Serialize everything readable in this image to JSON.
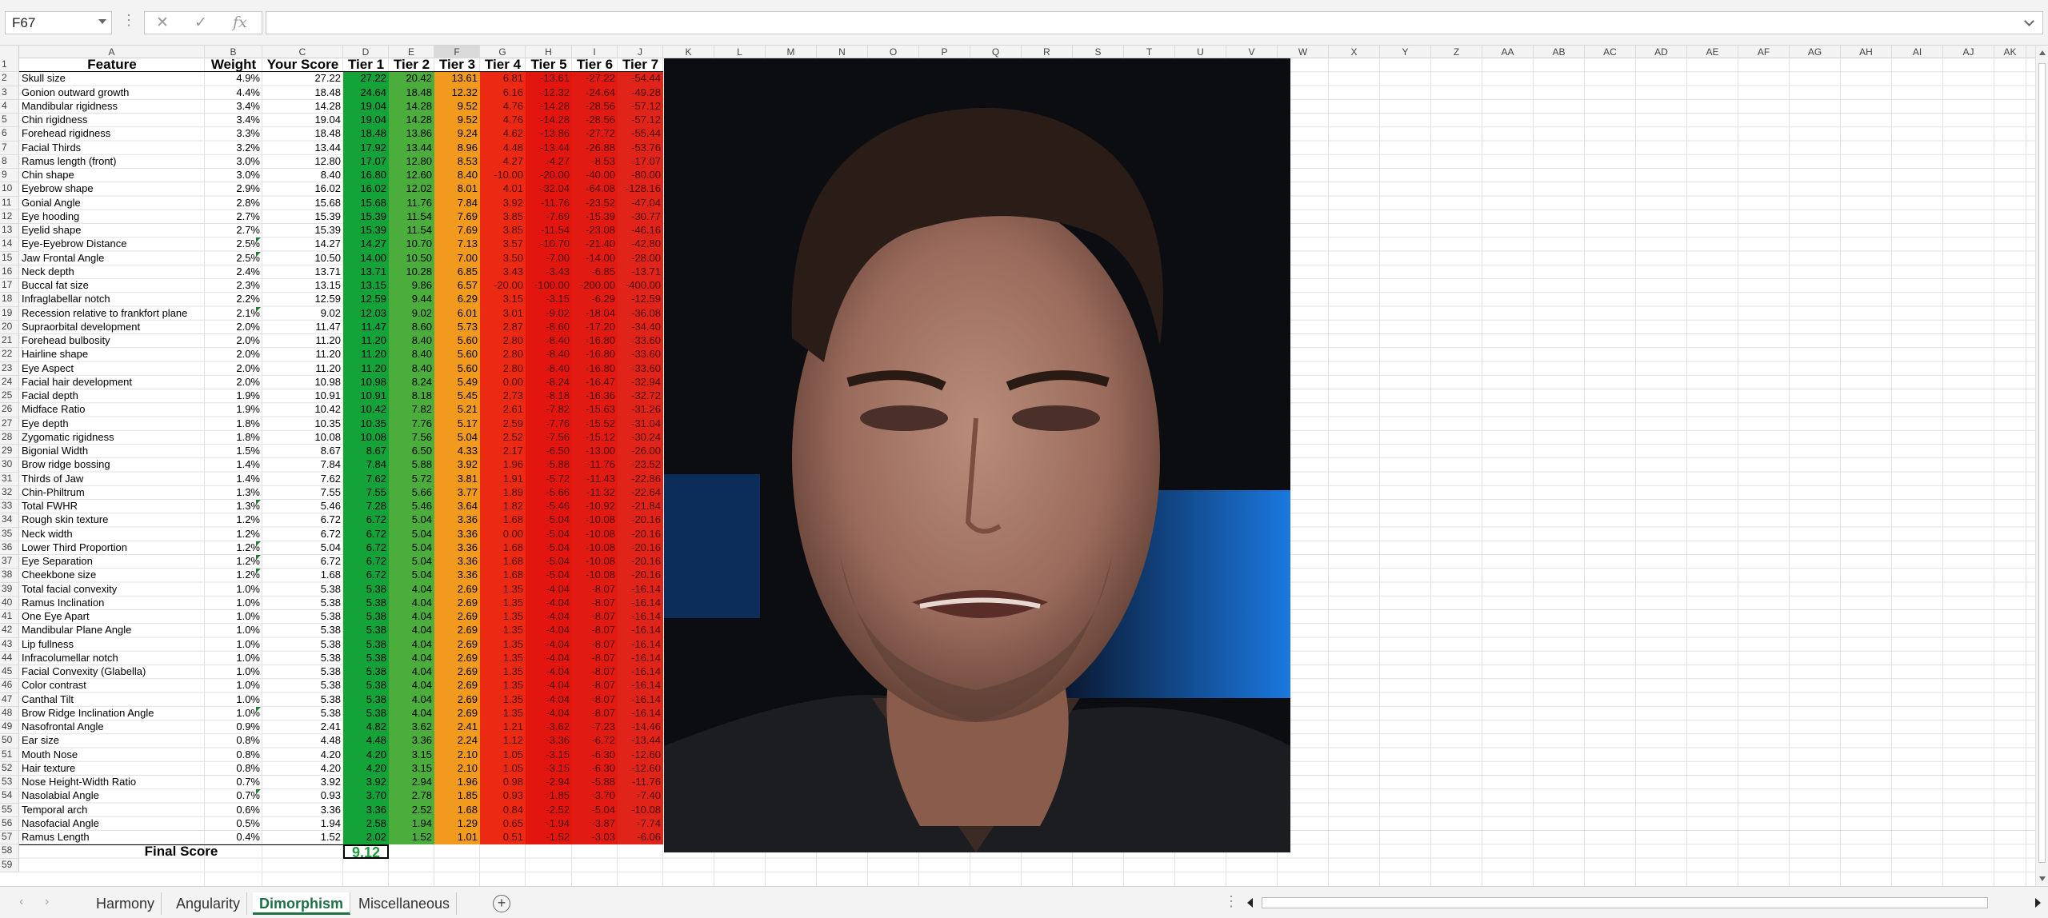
{
  "formula_bar": {
    "name_box": "F67",
    "formula": "",
    "icons": [
      "close-icon",
      "check-icon",
      "fx-icon"
    ]
  },
  "columns": [
    "A",
    "B",
    "C",
    "D",
    "E",
    "F",
    "G",
    "H",
    "I",
    "J",
    "K",
    "L",
    "M",
    "N",
    "O",
    "P",
    "Q",
    "R",
    "S",
    "T",
    "U",
    "V",
    "W",
    "X",
    "Y",
    "Z",
    "AA",
    "AB",
    "AC",
    "AD",
    "AE",
    "AF",
    "AG",
    "AH",
    "AI",
    "AJ",
    "AK"
  ],
  "selected_column": "F",
  "headers": [
    "Feature",
    "Weight",
    "Your Score",
    "Tier 1",
    "Tier 2",
    "Tier 3",
    "Tier 4",
    "Tier 5",
    "Tier 6",
    "Tier 7"
  ],
  "tier_colors": [
    "#14a339",
    "#4bad3b",
    "#f29a1e",
    "#ec2a13",
    "#e2160f",
    "#e11a12",
    "#e1241a"
  ],
  "rows": [
    [
      "Skull size",
      "4.9%",
      "27.22",
      "27.22",
      "20.42",
      "13.61",
      "6.81",
      "-13.61",
      "-27.22",
      "-54.44"
    ],
    [
      "Gonion outward growth",
      "4.4%",
      "18.48",
      "24.64",
      "18.48",
      "12.32",
      "6.16",
      "-12.32",
      "-24.64",
      "-49.28"
    ],
    [
      "Mandibular rigidness",
      "3.4%",
      "14.28",
      "19.04",
      "14.28",
      "9.52",
      "4.76",
      "-14.28",
      "-28.56",
      "-57.12"
    ],
    [
      "Chin rigidness",
      "3.4%",
      "19.04",
      "19.04",
      "14.28",
      "9.52",
      "4.76",
      "-14.28",
      "-28.56",
      "-57.12"
    ],
    [
      "Forehead rigidness",
      "3.3%",
      "18.48",
      "18.48",
      "13.86",
      "9.24",
      "4.62",
      "-13.86",
      "-27.72",
      "-55.44"
    ],
    [
      "Facial Thirds",
      "3.2%",
      "13.44",
      "17.92",
      "13.44",
      "8.96",
      "4.48",
      "-13.44",
      "-26.88",
      "-53.76"
    ],
    [
      "Ramus length (front)",
      "3.0%",
      "12.80",
      "17.07",
      "12.80",
      "8.53",
      "4.27",
      "-4.27",
      "-8.53",
      "-17.07"
    ],
    [
      "Chin shape",
      "3.0%",
      "8.40",
      "16.80",
      "12.60",
      "8.40",
      "-10.00",
      "-20.00",
      "-40.00",
      "-80.00"
    ],
    [
      "Eyebrow shape",
      "2.9%",
      "16.02",
      "16.02",
      "12.02",
      "8.01",
      "4.01",
      "-32.04",
      "-64.08",
      "-128.16"
    ],
    [
      "Gonial Angle",
      "2.8%",
      "15.68",
      "15.68",
      "11.76",
      "7.84",
      "3.92",
      "-11.76",
      "-23.52",
      "-47.04"
    ],
    [
      "Eye hooding",
      "2.7%",
      "15.39",
      "15.39",
      "11.54",
      "7.69",
      "3.85",
      "-7.69",
      "-15.39",
      "-30.77"
    ],
    [
      "Eyelid shape",
      "2.7%",
      "15.39",
      "15.39",
      "11.54",
      "7.69",
      "3.85",
      "-11.54",
      "-23.08",
      "-46.16"
    ],
    [
      "Eye-Eyebrow Distance",
      "2.5%",
      "14.27",
      "14.27",
      "10.70",
      "7.13",
      "3.57",
      "-10.70",
      "-21.40",
      "-42.80"
    ],
    [
      "Jaw Frontal Angle",
      "2.5%",
      "10.50",
      "14.00",
      "10.50",
      "7.00",
      "3.50",
      "-7.00",
      "-14.00",
      "-28.00"
    ],
    [
      "Neck depth",
      "2.4%",
      "13.71",
      "13.71",
      "10.28",
      "6.85",
      "3.43",
      "-3.43",
      "-6.85",
      "-13.71"
    ],
    [
      "Buccal fat size",
      "2.3%",
      "13.15",
      "13.15",
      "9.86",
      "6.57",
      "-20.00",
      "-100.00",
      "-200.00",
      "-400.00"
    ],
    [
      "Infraglabellar notch",
      "2.2%",
      "12.59",
      "12.59",
      "9.44",
      "6.29",
      "3.15",
      "-3.15",
      "-6.29",
      "-12.59"
    ],
    [
      "Recession relative to frankfort plane",
      "2.1%",
      "9.02",
      "12.03",
      "9.02",
      "6.01",
      "3.01",
      "-9.02",
      "-18.04",
      "-36.08"
    ],
    [
      "Supraorbital development",
      "2.0%",
      "11.47",
      "11.47",
      "8.60",
      "5.73",
      "2.87",
      "-8.60",
      "-17.20",
      "-34.40"
    ],
    [
      "Forehead bulbosity",
      "2.0%",
      "11.20",
      "11.20",
      "8.40",
      "5.60",
      "2.80",
      "-8.40",
      "-16.80",
      "-33.60"
    ],
    [
      "Hairline shape",
      "2.0%",
      "11.20",
      "11.20",
      "8.40",
      "5.60",
      "2.80",
      "-8.40",
      "-16.80",
      "-33.60"
    ],
    [
      "Eye Aspect",
      "2.0%",
      "11.20",
      "11.20",
      "8.40",
      "5.60",
      "2.80",
      "-8.40",
      "-16.80",
      "-33.60"
    ],
    [
      "Facial hair development",
      "2.0%",
      "10.98",
      "10.98",
      "8.24",
      "5.49",
      "0.00",
      "-8.24",
      "-16.47",
      "-32.94"
    ],
    [
      "Facial depth",
      "1.9%",
      "10.91",
      "10.91",
      "8.18",
      "5.45",
      "2.73",
      "-8.18",
      "-16.36",
      "-32.72"
    ],
    [
      "Midface Ratio",
      "1.9%",
      "10.42",
      "10.42",
      "7.82",
      "5.21",
      "2.61",
      "-7.82",
      "-15.63",
      "-31.26"
    ],
    [
      "Eye depth",
      "1.8%",
      "10.35",
      "10.35",
      "7.76",
      "5.17",
      "2.59",
      "-7.76",
      "-15.52",
      "-31.04"
    ],
    [
      "Zygomatic rigidness",
      "1.8%",
      "10.08",
      "10.08",
      "7.56",
      "5.04",
      "2.52",
      "-7.56",
      "-15.12",
      "-30.24"
    ],
    [
      "Bigonial Width",
      "1.5%",
      "8.67",
      "8.67",
      "6.50",
      "4.33",
      "2.17",
      "-6.50",
      "-13.00",
      "-26.00"
    ],
    [
      "Brow ridge bossing",
      "1.4%",
      "7.84",
      "7.84",
      "5.88",
      "3.92",
      "1.96",
      "-5.88",
      "-11.76",
      "-23.52"
    ],
    [
      "Thirds of Jaw",
      "1.4%",
      "7.62",
      "7.62",
      "5.72",
      "3.81",
      "1.91",
      "-5.72",
      "-11.43",
      "-22.86"
    ],
    [
      "Chin-Philtrum",
      "1.3%",
      "7.55",
      "7.55",
      "5.66",
      "3.77",
      "1.89",
      "-5.66",
      "-11.32",
      "-22.64"
    ],
    [
      "Total FWHR",
      "1.3%",
      "5.46",
      "7.28",
      "5.46",
      "3.64",
      "1.82",
      "-5.46",
      "-10.92",
      "-21.84"
    ],
    [
      "Rough skin texture",
      "1.2%",
      "6.72",
      "6.72",
      "5.04",
      "3.36",
      "1.68",
      "-5.04",
      "-10.08",
      "-20.16"
    ],
    [
      "Neck width",
      "1.2%",
      "6.72",
      "6.72",
      "5.04",
      "3.36",
      "0.00",
      "-5.04",
      "-10.08",
      "-20.16"
    ],
    [
      "Lower Third Proportion",
      "1.2%",
      "5.04",
      "6.72",
      "5.04",
      "3.36",
      "1.68",
      "-5.04",
      "-10.08",
      "-20.16"
    ],
    [
      "Eye Separation",
      "1.2%",
      "6.72",
      "6.72",
      "5.04",
      "3.36",
      "1.68",
      "-5.04",
      "-10.08",
      "-20.16"
    ],
    [
      "Cheekbone size",
      "1.2%",
      "1.68",
      "6.72",
      "5.04",
      "3.36",
      "1.68",
      "-5.04",
      "-10.08",
      "-20.16"
    ],
    [
      "Total facial convexity",
      "1.0%",
      "5.38",
      "5.38",
      "4.04",
      "2.69",
      "1.35",
      "-4.04",
      "-8.07",
      "-16.14"
    ],
    [
      "Ramus Inclination",
      "1.0%",
      "5.38",
      "5.38",
      "4.04",
      "2.69",
      "1.35",
      "-4.04",
      "-8.07",
      "-16.14"
    ],
    [
      "One Eye Apart",
      "1.0%",
      "5.38",
      "5.38",
      "4.04",
      "2.69",
      "1.35",
      "-4.04",
      "-8.07",
      "-16.14"
    ],
    [
      "Mandibular Plane Angle",
      "1.0%",
      "5.38",
      "5.38",
      "4.04",
      "2.69",
      "1.35",
      "-4.04",
      "-8.07",
      "-16.14"
    ],
    [
      "Lip fullness",
      "1.0%",
      "5.38",
      "5.38",
      "4.04",
      "2.69",
      "1.35",
      "-4.04",
      "-8.07",
      "-16.14"
    ],
    [
      "Infracolumellar notch",
      "1.0%",
      "5.38",
      "5.38",
      "4.04",
      "2.69",
      "1.35",
      "-4.04",
      "-8.07",
      "-16.14"
    ],
    [
      "Facial Convexity (Glabella)",
      "1.0%",
      "5.38",
      "5.38",
      "4.04",
      "2.69",
      "1.35",
      "-4.04",
      "-8.07",
      "-16.14"
    ],
    [
      "Color contrast",
      "1.0%",
      "5.38",
      "5.38",
      "4.04",
      "2.69",
      "1.35",
      "-4.04",
      "-8.07",
      "-16.14"
    ],
    [
      "Canthal Tilt",
      "1.0%",
      "5.38",
      "5.38",
      "4.04",
      "2.69",
      "1.35",
      "-4.04",
      "-8.07",
      "-16.14"
    ],
    [
      "Brow Ridge Inclination Angle",
      "1.0%",
      "5.38",
      "5.38",
      "4.04",
      "2.69",
      "1.35",
      "-4.04",
      "-8.07",
      "-16.14"
    ],
    [
      "Nasofrontal Angle",
      "0.9%",
      "2.41",
      "4.82",
      "3.62",
      "2.41",
      "1.21",
      "-3.62",
      "-7.23",
      "-14.46"
    ],
    [
      "Ear size",
      "0.8%",
      "4.48",
      "4.48",
      "3.36",
      "2.24",
      "1.12",
      "-3.36",
      "-6.72",
      "-13.44"
    ],
    [
      "Mouth Nose",
      "0.8%",
      "4.20",
      "4.20",
      "3.15",
      "2.10",
      "1.05",
      "-3.15",
      "-6.30",
      "-12.60"
    ],
    [
      "Hair texture",
      "0.8%",
      "4.20",
      "4.20",
      "3.15",
      "2.10",
      "1.05",
      "-3.15",
      "-6.30",
      "-12.60"
    ],
    [
      "Nose Height-Width Ratio",
      "0.7%",
      "3.92",
      "3.92",
      "2.94",
      "1.96",
      "0.98",
      "-2.94",
      "-5.88",
      "-11.76"
    ],
    [
      "Nasolabial Angle",
      "0.7%",
      "0.93",
      "3.70",
      "2.78",
      "1.85",
      "0.93",
      "-1.85",
      "-3.70",
      "-7.40"
    ],
    [
      "Temporal arch",
      "0.6%",
      "3.36",
      "3.36",
      "2.52",
      "1.68",
      "0.84",
      "-2.52",
      "-5.04",
      "-10.08"
    ],
    [
      "Nasofacial Angle",
      "0.5%",
      "1.94",
      "2.58",
      "1.94",
      "1.29",
      "0.65",
      "-1.94",
      "-3.87",
      "-7.74"
    ],
    [
      "Ramus Length",
      "0.4%",
      "1.52",
      "2.02",
      "1.52",
      "1.01",
      "0.51",
      "-1.52",
      "-3.03",
      "-6.06"
    ]
  ],
  "flagged_rows": [
    14,
    15,
    19,
    33,
    36,
    37,
    38,
    48,
    54
  ],
  "final": {
    "label": "Final Score",
    "value": "9.12",
    "color": "#1e9b3c"
  },
  "sheet_tabs": [
    {
      "label": "Harmony",
      "active": false
    },
    {
      "label": "Angularity",
      "active": false
    },
    {
      "label": "Dimorphism",
      "active": true
    },
    {
      "label": "Miscellaneous",
      "active": false
    }
  ]
}
